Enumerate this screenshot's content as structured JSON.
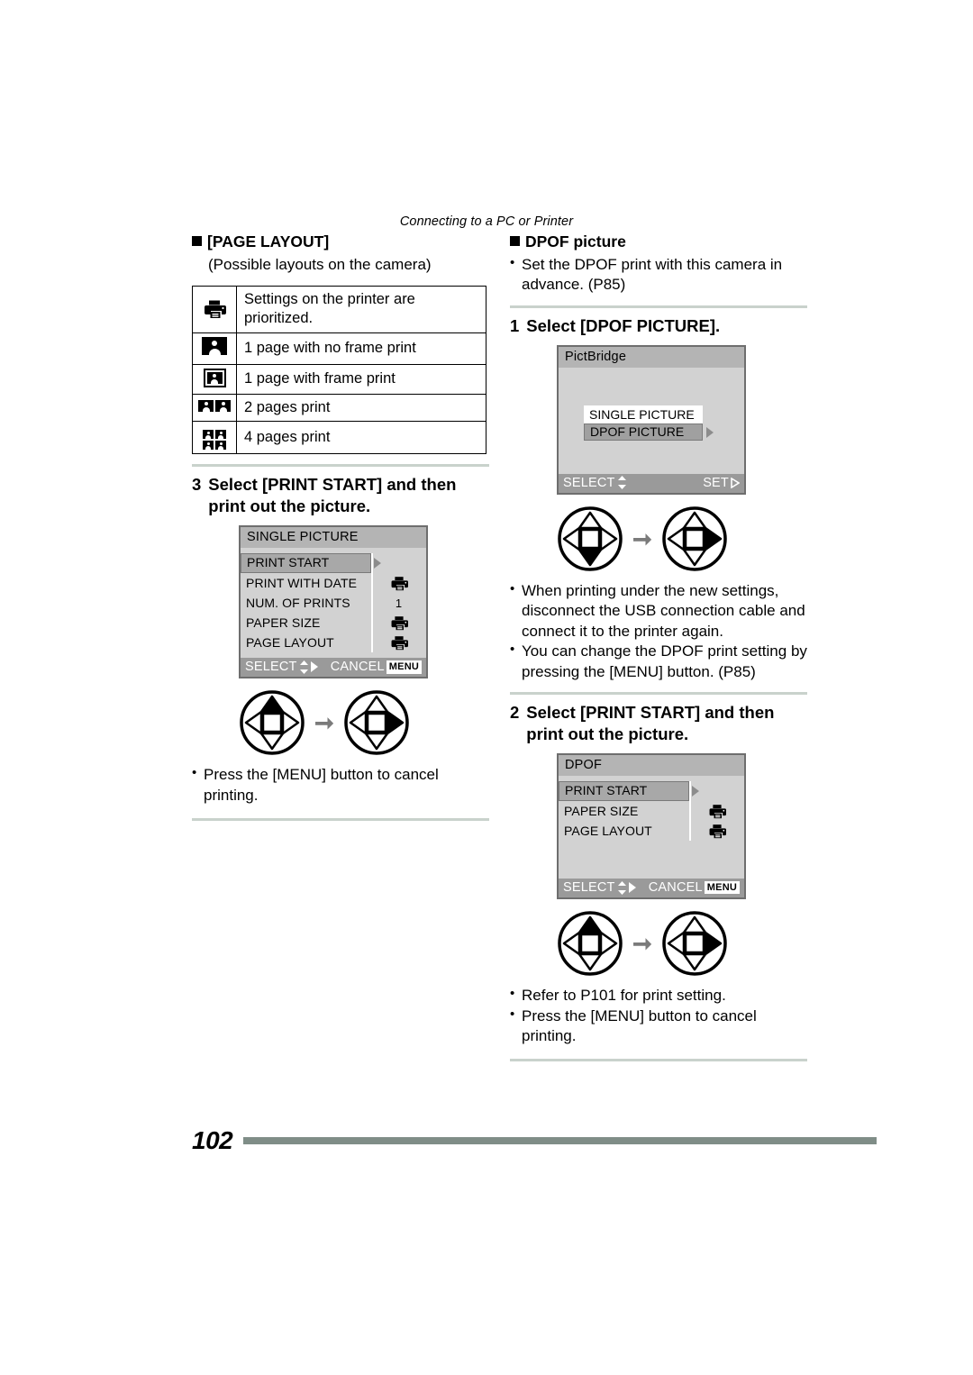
{
  "header": {
    "running_head": "Connecting to a PC or Printer"
  },
  "footer": {
    "page_number": "102"
  },
  "left_column": {
    "page_layout_heading": "[PAGE LAYOUT]",
    "page_layout_subnote": "(Possible layouts on the camera)",
    "layout_table": [
      {
        "icon": "printer-icon",
        "description": "Settings on the printer are prioritized."
      },
      {
        "icon": "one-page-no-frame-icon",
        "description": "1 page with no frame print"
      },
      {
        "icon": "one-page-with-frame-icon",
        "description": "1 page with frame print"
      },
      {
        "icon": "two-pages-icon",
        "description": "2 pages print"
      },
      {
        "icon": "four-pages-icon",
        "description": "4 pages print"
      }
    ],
    "step": {
      "number": "3",
      "text": "Select [PRINT START] and then print out the picture."
    },
    "lcd": {
      "title": "SINGLE PICTURE",
      "rows": [
        {
          "label": "PRINT START",
          "value": "",
          "highlighted": true
        },
        {
          "label": "PRINT WITH DATE",
          "value": "printer-icon",
          "highlighted": false
        },
        {
          "label": "NUM. OF PRINTS",
          "value": "1",
          "highlighted": false
        },
        {
          "label": "PAPER SIZE",
          "value": "printer-icon",
          "highlighted": false
        },
        {
          "label": "PAGE LAYOUT",
          "value": "printer-icon",
          "highlighted": false
        }
      ],
      "footer_left": "SELECT",
      "footer_left_glyph": "updown-right-arrows-icon",
      "footer_right": "CANCEL",
      "footer_right_chip": "MENU"
    },
    "joystick": {
      "first_pressed": "up",
      "second_pressed": "right"
    },
    "notes": [
      "Press the [MENU] button to cancel printing."
    ]
  },
  "right_column": {
    "dpof_heading": "DPOF picture",
    "dpof_notes": [
      "Set the DPOF print with this camera in advance. (P85)"
    ],
    "step1": {
      "number": "1",
      "text": "Select [DPOF PICTURE]."
    },
    "lcd1": {
      "title": "PictBridge",
      "options": [
        {
          "label": "SINGLE PICTURE",
          "highlighted": false
        },
        {
          "label": "DPOF PICTURE",
          "highlighted": true
        }
      ],
      "footer_left": "SELECT",
      "footer_left_glyph": "updown-arrows-icon",
      "footer_right": "SET",
      "footer_right_glyph": "right-arrow-icon"
    },
    "joystick1": {
      "first_pressed": "down",
      "second_pressed": "right"
    },
    "notes_mid": [
      "When printing under the new settings, disconnect the USB connection cable and connect it to the printer again.",
      "You can change the DPOF print setting by pressing the [MENU] button. (P85)"
    ],
    "step2": {
      "number": "2",
      "text": "Select [PRINT START] and then print out the picture."
    },
    "lcd2": {
      "title": "DPOF",
      "rows": [
        {
          "label": "PRINT START",
          "value": "",
          "highlighted": true
        },
        {
          "label": "PAPER SIZE",
          "value": "printer-icon",
          "highlighted": false
        },
        {
          "label": "PAGE LAYOUT",
          "value": "printer-icon",
          "highlighted": false
        }
      ],
      "footer_left": "SELECT",
      "footer_left_glyph": "updown-right-arrows-icon",
      "footer_right": "CANCEL",
      "footer_right_chip": "MENU"
    },
    "joystick2": {
      "first_pressed": "up",
      "second_pressed": "right"
    },
    "notes_bottom": [
      "Refer to P101 for print setting.",
      "Press the [MENU] button to cancel printing."
    ]
  },
  "colors": {
    "rule": "#c9d2cc",
    "footer_bar": "#7f8d87",
    "lcd_body": "#d2d2d2",
    "lcd_title": "#b4b4b4",
    "lcd_footer": "#9a9a9a",
    "highlight": "#a8a8a8"
  }
}
